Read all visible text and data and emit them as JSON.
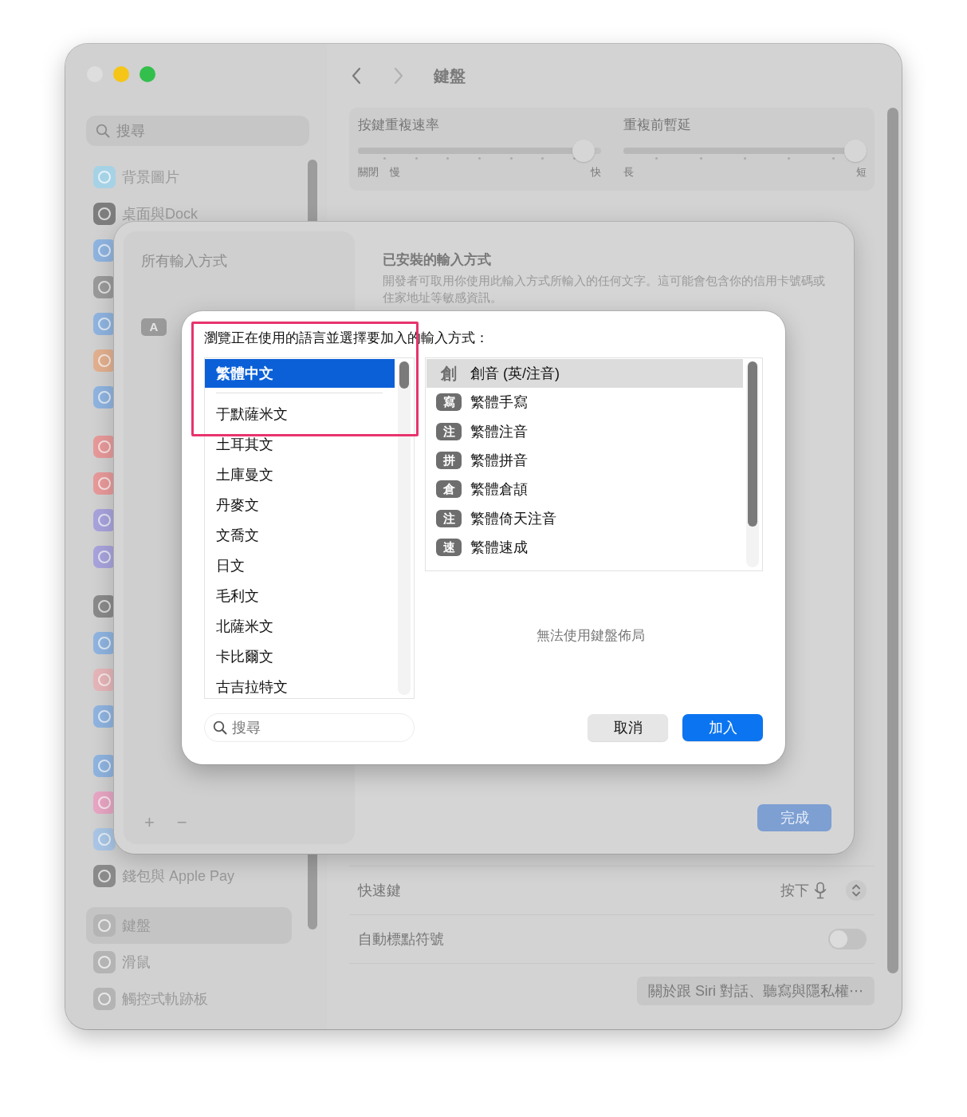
{
  "window": {
    "traffic_lights": [
      {
        "color": "#dedede"
      },
      {
        "color": "#f5c518"
      },
      {
        "color": "#33bf4c"
      }
    ]
  },
  "sidebar": {
    "search": {
      "placeholder": "搜尋"
    },
    "groups": [
      {
        "items": [
          {
            "label": "背景圖片",
            "color": "#a6d2e6",
            "selected": false
          },
          {
            "label": "桌面與Dock",
            "color": "#7d7d7d",
            "selected": false
          },
          {
            "color": "#8fb4e0",
            "selected": false
          },
          {
            "color": "#9a9a9a",
            "selected": false
          },
          {
            "color": "#8fb4e0",
            "selected": false
          },
          {
            "color": "#e3b08f",
            "selected": false
          },
          {
            "color": "#8fb4e0",
            "selected": false
          }
        ]
      },
      {
        "items": [
          {
            "color": "#e8999a",
            "selected": false
          },
          {
            "color": "#e8999a",
            "selected": false
          },
          {
            "color": "#a8a3dc",
            "selected": false
          },
          {
            "color": "#a8a3dc",
            "selected": false
          }
        ]
      },
      {
        "items": [
          {
            "color": "#8a8a8a",
            "selected": false
          },
          {
            "color": "#8fb4e0",
            "selected": false
          },
          {
            "color": "#e6b5b9",
            "selected": false
          },
          {
            "color": "#8fb4e0",
            "selected": false
          }
        ]
      },
      {
        "items": [
          {
            "color": "#8fb4e0",
            "selected": false
          },
          {
            "color": "#e8a6c4",
            "selected": false
          },
          {
            "color": "#a9c6e6",
            "selected": false
          },
          {
            "label": "錢包與 Apple Pay",
            "color": "#8a8a8a",
            "selected": false
          }
        ]
      },
      {
        "items": [
          {
            "label": "鍵盤",
            "color": "#b4b4b4",
            "selected": true
          },
          {
            "label": "滑鼠",
            "color": "#b4b4b4",
            "selected": false
          },
          {
            "label": "觸控式軌跡板",
            "color": "#b4b4b4",
            "selected": false
          }
        ]
      }
    ]
  },
  "toolbar": {
    "title": "鍵盤"
  },
  "sliders": [
    {
      "kind": "rate",
      "title": "按鍵重複速率",
      "level": 0.97,
      "left_labels": [
        "關閉",
        "慢"
      ],
      "right_label": "快"
    },
    {
      "kind": "delay",
      "title": "重複前暫延",
      "level": 1,
      "left_labels": [
        "長"
      ],
      "right_label": "短"
    }
  ],
  "settings_rows": [
    {
      "kind": "popup",
      "label": "快速鍵",
      "value": "按下"
    },
    {
      "kind": "toggle",
      "label": "自動標點符號",
      "on": false
    }
  ],
  "about_button": "關於跟 Siri 對話、聽寫與隱私權⋯",
  "sheet": {
    "sidebar_title": "所有輸入方式",
    "sources": [
      {
        "badge": "A"
      }
    ],
    "add": "+",
    "remove": "−",
    "title": "已安裝的輸入方式",
    "description": "開發者可取用你使用此輸入方式所輸入的任何文字。這可能會包含你的信用卡號碼或住家地址等敏感資訊。",
    "done": "完成"
  },
  "dialog": {
    "prompt": "瀏覽正在使用的語言並選擇要加入的輸入方式：",
    "language_groups": [
      {
        "items": [
          {
            "label": "繁體中文",
            "selected": true
          }
        ]
      },
      {
        "items": [
          {
            "label": "于默薩米文",
            "selected": false
          },
          {
            "label": "土耳其文",
            "selected": false
          },
          {
            "label": "土庫曼文",
            "selected": false
          },
          {
            "label": "丹麥文",
            "selected": false
          },
          {
            "label": "文喬文",
            "selected": false
          },
          {
            "label": "日文",
            "selected": false
          },
          {
            "label": "毛利文",
            "selected": false
          },
          {
            "label": "北薩米文",
            "selected": false
          },
          {
            "label": "卡比爾文",
            "selected": false
          },
          {
            "label": "古吉拉特文",
            "selected": false
          }
        ]
      }
    ],
    "methods": [
      {
        "kind": "plain",
        "badge": "創",
        "label": "創音 (英/注音)",
        "selected": true
      },
      {
        "kind": "boxed",
        "badge": "寫",
        "label": "繁體手寫",
        "selected": false
      },
      {
        "kind": "boxed",
        "badge": "注",
        "label": "繁體注音",
        "selected": false
      },
      {
        "kind": "boxed",
        "badge": "拼",
        "label": "繁體拼音",
        "selected": false
      },
      {
        "kind": "boxed",
        "badge": "倉",
        "label": "繁體倉頡",
        "selected": false
      },
      {
        "kind": "boxed",
        "badge": "注",
        "label": "繁體倚天注音",
        "selected": false
      },
      {
        "kind": "boxed",
        "badge": "速",
        "label": "繁體速成",
        "selected": false
      }
    ],
    "layout_note": "無法使用鍵盤佈局",
    "search": {
      "placeholder": "搜尋"
    },
    "buttons": [
      {
        "kind": "secondary",
        "label": "取消"
      },
      {
        "kind": "primary",
        "label": "加入"
      }
    ]
  }
}
